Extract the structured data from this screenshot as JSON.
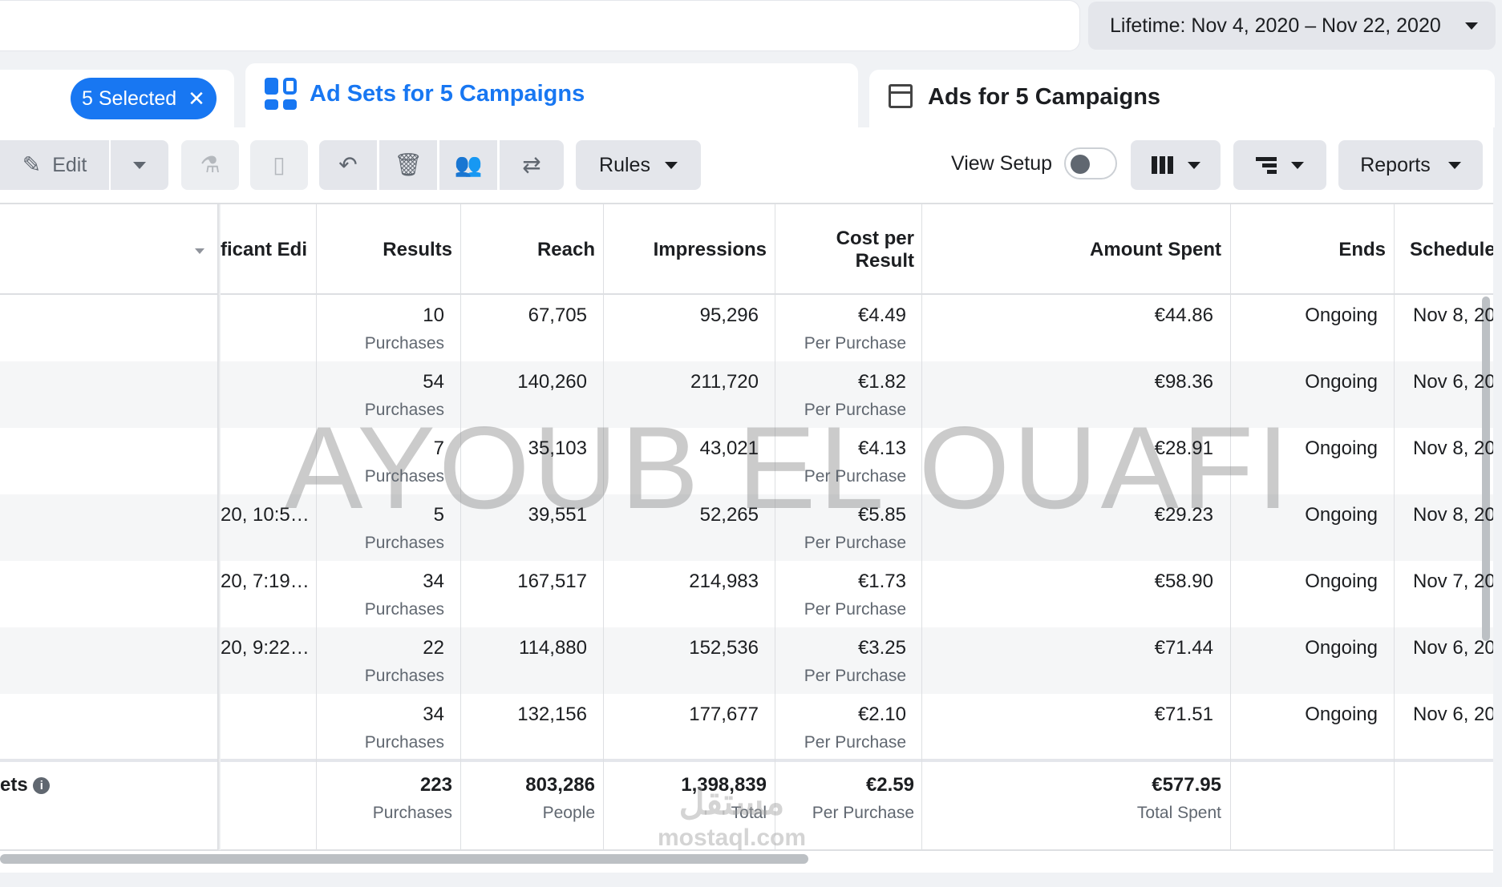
{
  "date_range": {
    "label": "Lifetime: Nov 4, 2020 – Nov 22, 2020"
  },
  "tabs": {
    "campaigns": {
      "selected_chip": "5 Selected"
    },
    "adsets": {
      "title": "Ad Sets for 5 Campaigns"
    },
    "ads": {
      "title": "Ads for 5 Campaigns"
    }
  },
  "toolbar": {
    "edit_label": "Edit",
    "rules_label": "Rules",
    "view_setup_label": "View Setup",
    "reports_label": "Reports"
  },
  "table": {
    "columns": [
      "ficant Edit",
      "Results",
      "Reach",
      "Impressions",
      "Cost per Result",
      "Amount Spent",
      "Ends",
      "Schedule"
    ],
    "rows": [
      {
        "edit": "",
        "results": "10",
        "results_sub": "Purchases",
        "reach": "67,705",
        "impressions": "95,296",
        "cpr": "€4.49",
        "cpr_sub": "Per Purchase",
        "spent": "€44.86",
        "ends": "Ongoing",
        "schedule": "Nov 8, 20"
      },
      {
        "edit": "",
        "results": "54",
        "results_sub": "Purchases",
        "reach": "140,260",
        "impressions": "211,720",
        "cpr": "€1.82",
        "cpr_sub": "Per Purchase",
        "spent": "€98.36",
        "ends": "Ongoing",
        "schedule": "Nov 6, 20"
      },
      {
        "edit": "",
        "results": "7",
        "results_sub": "Purchases",
        "reach": "35,103",
        "impressions": "43,021",
        "cpr": "€4.13",
        "cpr_sub": "Per Purchase",
        "spent": "€28.91",
        "ends": "Ongoing",
        "schedule": "Nov 8, 20"
      },
      {
        "edit": "20, 10:5…",
        "results": "5",
        "results_sub": "Purchases",
        "reach": "39,551",
        "impressions": "52,265",
        "cpr": "€5.85",
        "cpr_sub": "Per Purchase",
        "spent": "€29.23",
        "ends": "Ongoing",
        "schedule": "Nov 8, 20"
      },
      {
        "edit": "20, 7:19…",
        "results": "34",
        "results_sub": "Purchases",
        "reach": "167,517",
        "impressions": "214,983",
        "cpr": "€1.73",
        "cpr_sub": "Per Purchase",
        "spent": "€58.90",
        "ends": "Ongoing",
        "schedule": "Nov 7, 20"
      },
      {
        "edit": "20, 9:22…",
        "results": "22",
        "results_sub": "Purchases",
        "reach": "114,880",
        "impressions": "152,536",
        "cpr": "€3.25",
        "cpr_sub": "Per Purchase",
        "spent": "€71.44",
        "ends": "Ongoing",
        "schedule": "Nov 6, 20"
      },
      {
        "edit": "",
        "results": "34",
        "results_sub": "Purchases",
        "reach": "132,156",
        "impressions": "177,677",
        "cpr": "€2.10",
        "cpr_sub": "Per Purchase",
        "spent": "€71.51",
        "ends": "Ongoing",
        "schedule": "Nov 6, 20"
      }
    ],
    "totals": {
      "label": "ets",
      "results": "223",
      "results_sub": "Purchases",
      "reach": "803,286",
      "reach_sub": "People",
      "impressions": "1,398,839",
      "impressions_sub": "Total",
      "cpr": "€2.59",
      "cpr_sub": "Per Purchase",
      "spent": "€577.95",
      "spent_sub": "Total Spent"
    }
  },
  "watermark": {
    "text": "AYOUB EL OUAFI",
    "logo_text": "مستقل",
    "logo_sub": "mostaql.com"
  }
}
